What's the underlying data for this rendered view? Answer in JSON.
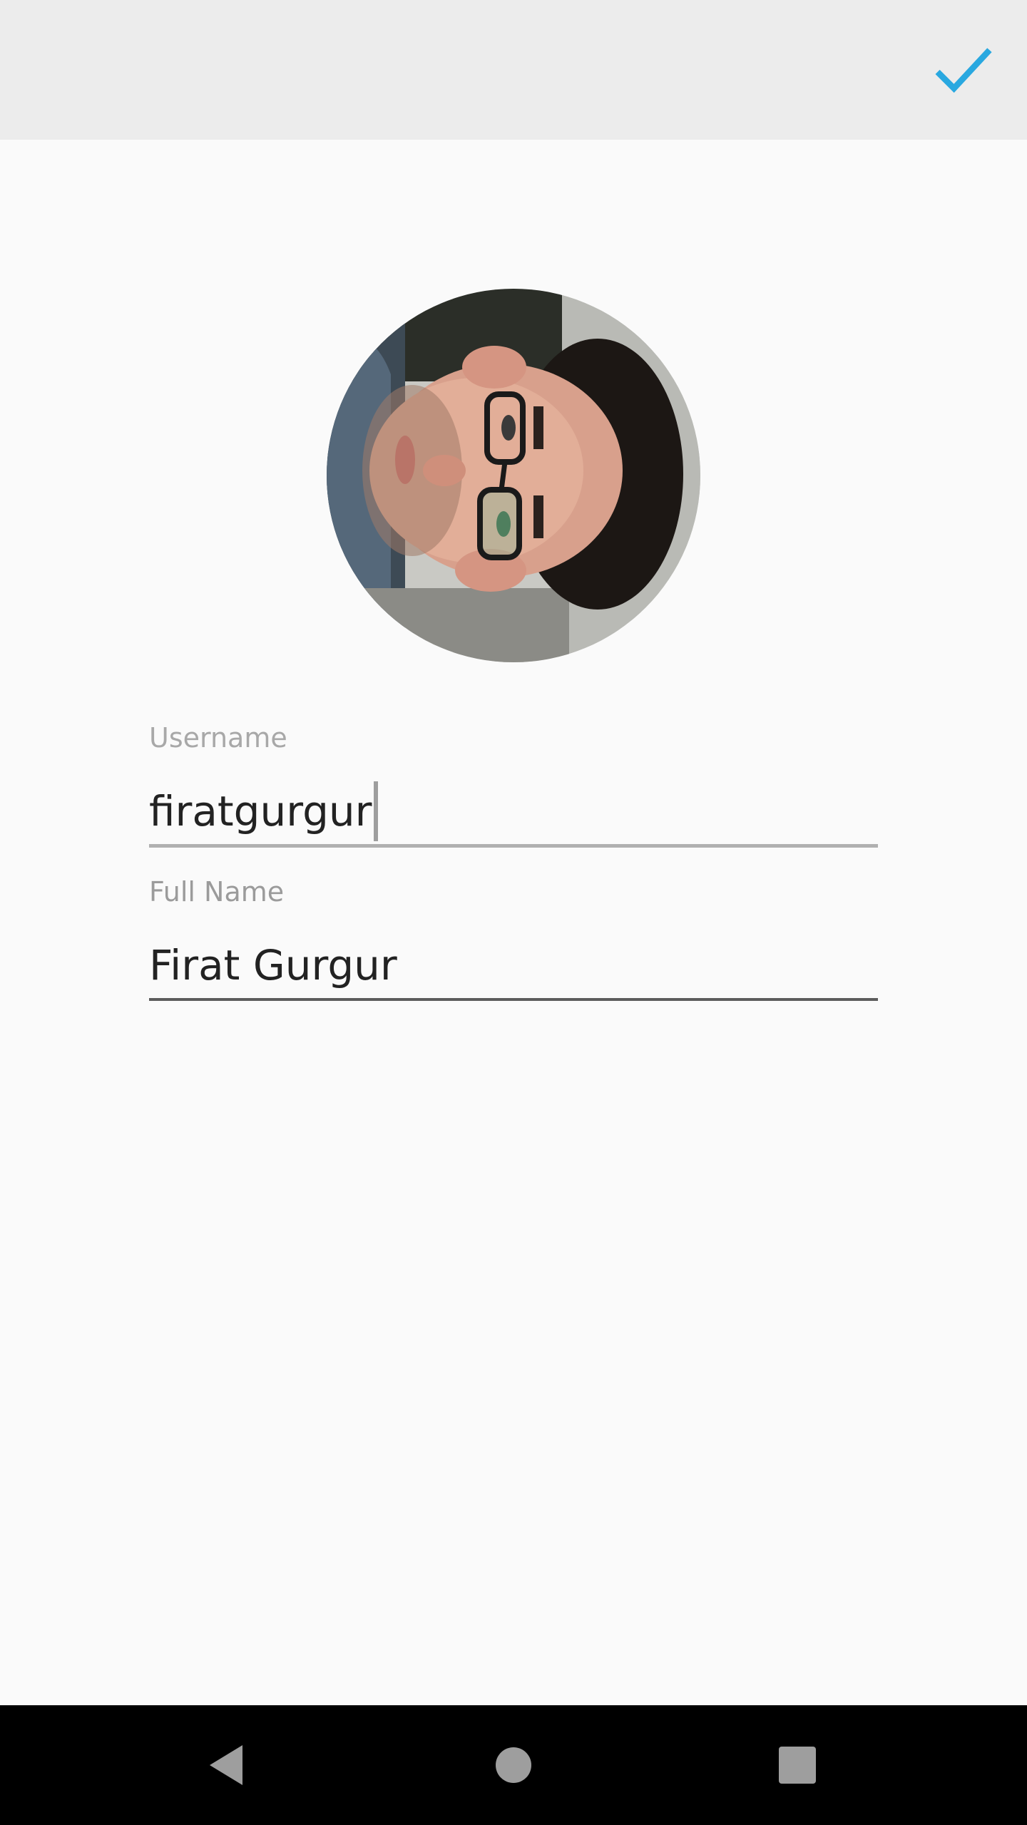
{
  "appbar": {
    "confirm_icon": "checkmark-icon",
    "accent_color": "#29a8e0"
  },
  "profile": {
    "avatar_icon": "profile-photo"
  },
  "form": {
    "username": {
      "label": "Username",
      "value": "firatgurgur"
    },
    "full_name": {
      "label": "Full Name",
      "value": "Firat Gurgur"
    }
  },
  "navigation": {
    "back_icon": "back-triangle-icon",
    "home_icon": "home-circle-icon",
    "recents_icon": "recents-square-icon"
  }
}
